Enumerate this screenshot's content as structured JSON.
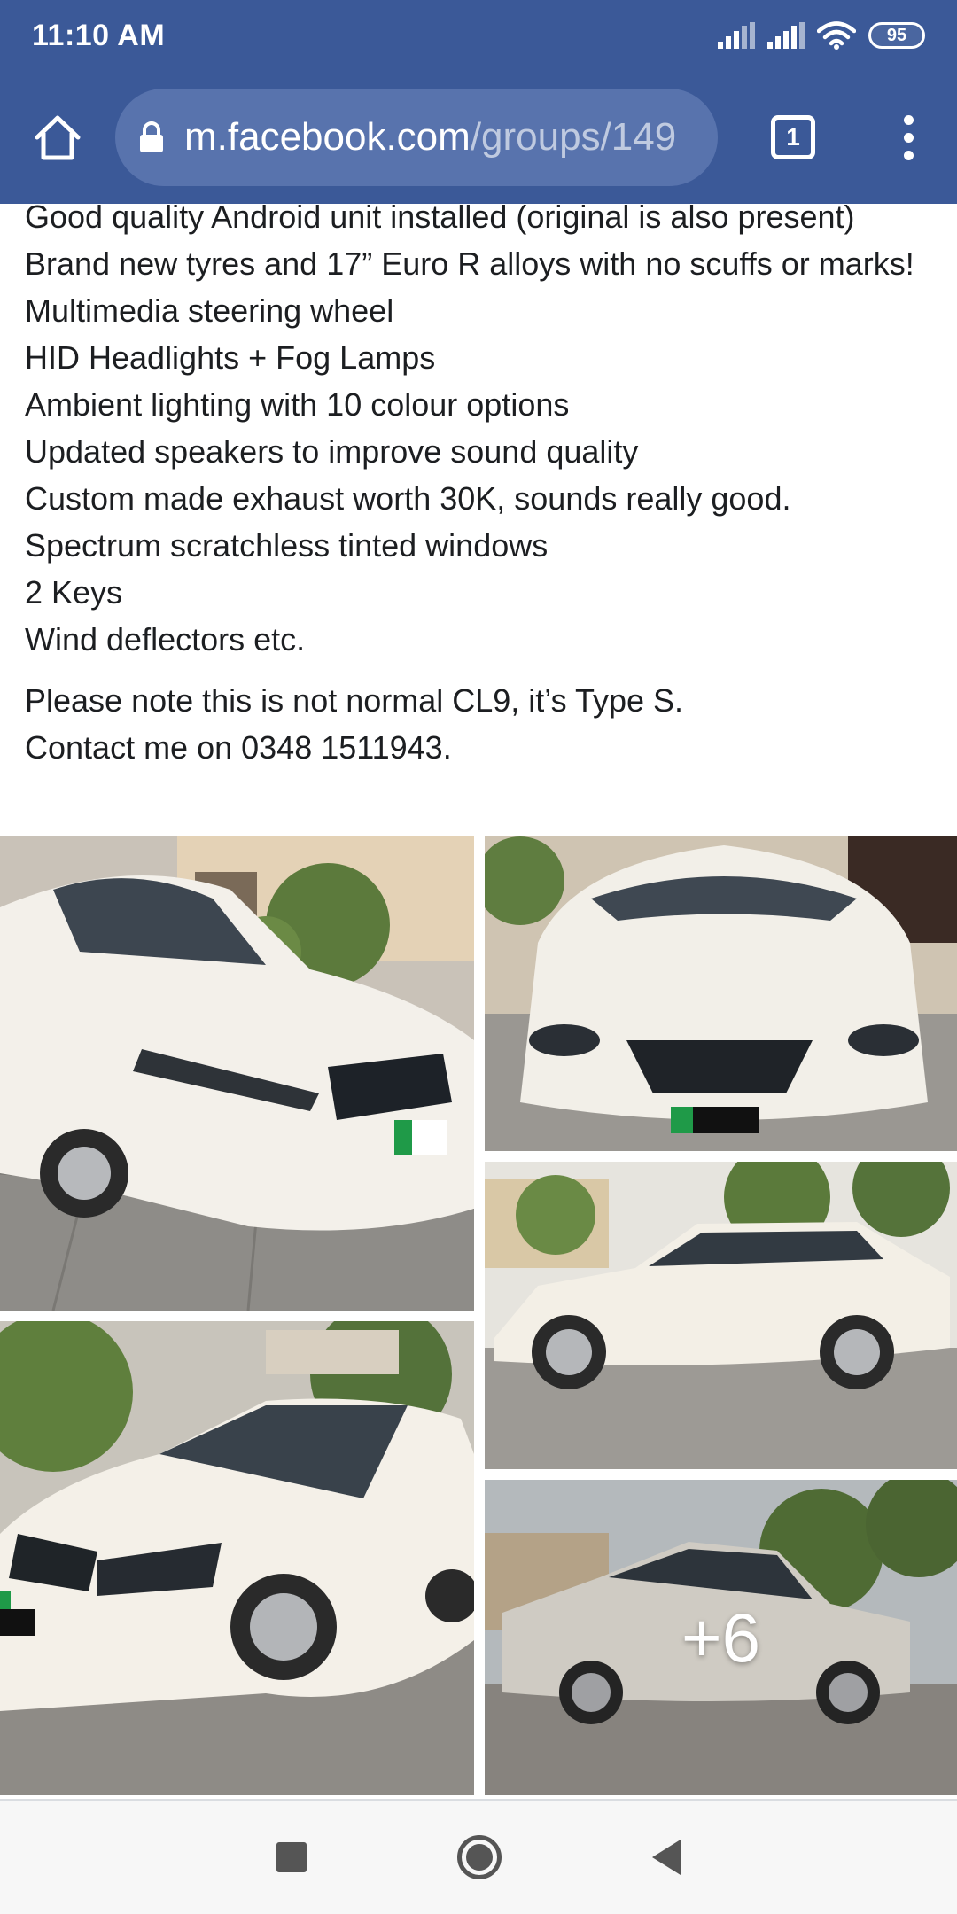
{
  "status_bar": {
    "time": "11:10 AM",
    "battery": "95",
    "icons": [
      "signal-icon",
      "signal-icon",
      "wifi-icon",
      "battery-icon"
    ]
  },
  "browser": {
    "url_domain": "m.facebook.com",
    "url_path": "/groups/149",
    "tab_count": "1",
    "icons": [
      "home-icon",
      "lock-icon",
      "tabs-icon",
      "more-vert-icon"
    ]
  },
  "post": {
    "lines": [
      "Good quality Android unit installed (original is also present)",
      "Brand new tyres and 17” Euro R alloys with no scuffs or marks!",
      "Multimedia steering wheel",
      "HID Headlights + Fog Lamps",
      "Ambient lighting with 10 colour options",
      "Updated speakers to improve sound quality",
      "Custom made exhaust worth 30K, sounds really good.",
      "Spectrum scratchless tinted windows",
      "2 Keys",
      "Wind deflectors etc."
    ],
    "note_lines": [
      "Please note this is not normal CL9, it’s Type S.",
      "Contact me on 0348 1511943."
    ]
  },
  "photos": {
    "count": 5,
    "more_count": "+6",
    "subjects": [
      "white sedan front three-quarter view",
      "white sedan front view",
      "white sedan side view",
      "white sedan front three-quarter view",
      "white sedan rear three-quarter view"
    ]
  },
  "nav": {
    "icons": [
      "recents-icon",
      "home-icon",
      "back-icon"
    ]
  }
}
